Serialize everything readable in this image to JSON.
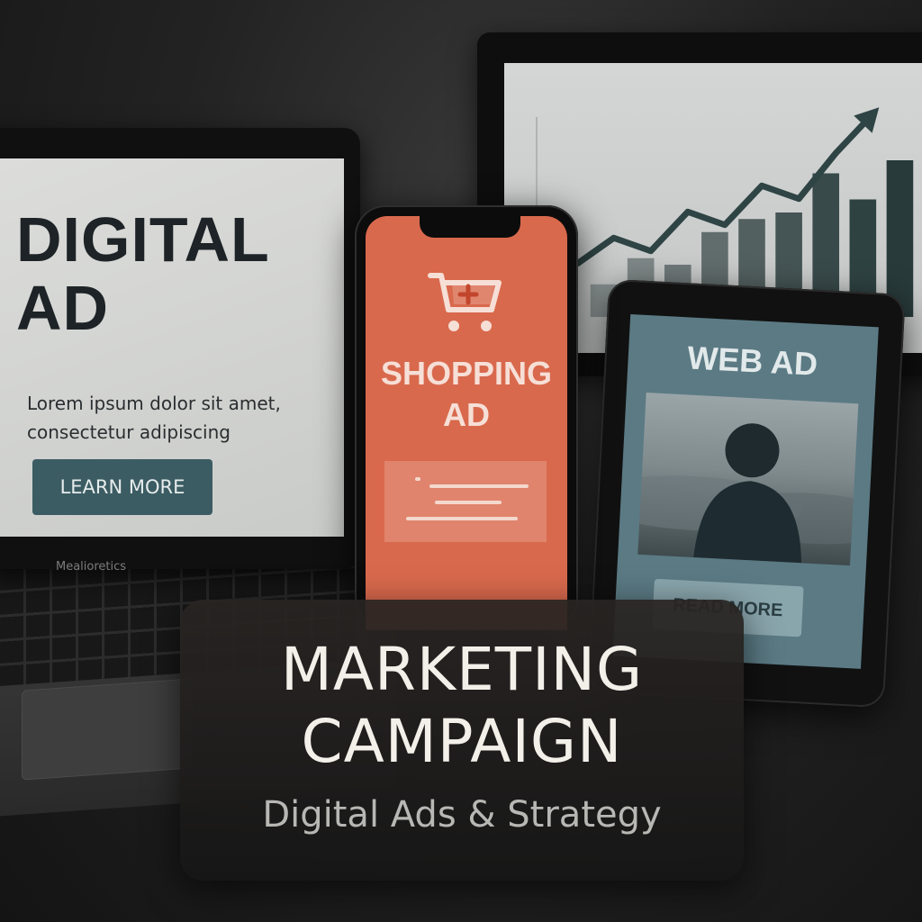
{
  "laptop": {
    "headline": "DIGITAL AD",
    "body": "Lorem ipsum dolor sit amet, consectetur adipiscing",
    "button_label": "LEARN MORE",
    "brand": "Mealioretics"
  },
  "phone": {
    "icon": "shopping-cart-icon",
    "title": "SHOPPING AD"
  },
  "tablet": {
    "title": "WEB AD",
    "button_label": "READ MORE"
  },
  "monitor": {
    "chart_data": {
      "type": "bar",
      "values": [
        5,
        9,
        8,
        13,
        15,
        16,
        22,
        18,
        24
      ],
      "trend_line": [
        7,
        11,
        9,
        15,
        13,
        19,
        17,
        24,
        30
      ],
      "title": "",
      "xlabel": "",
      "ylabel": "",
      "ylim": [
        0,
        32
      ],
      "grid": false
    }
  },
  "campaign": {
    "title": "MARKETING CAMPAIGN",
    "subtitle": "Digital Ads & Strategy"
  },
  "colors": {
    "phone_bg": "#d9694d",
    "tablet_screen": "#5b7a84",
    "button_teal": "#3b5c62",
    "card_bg": "#1e1e1e"
  }
}
